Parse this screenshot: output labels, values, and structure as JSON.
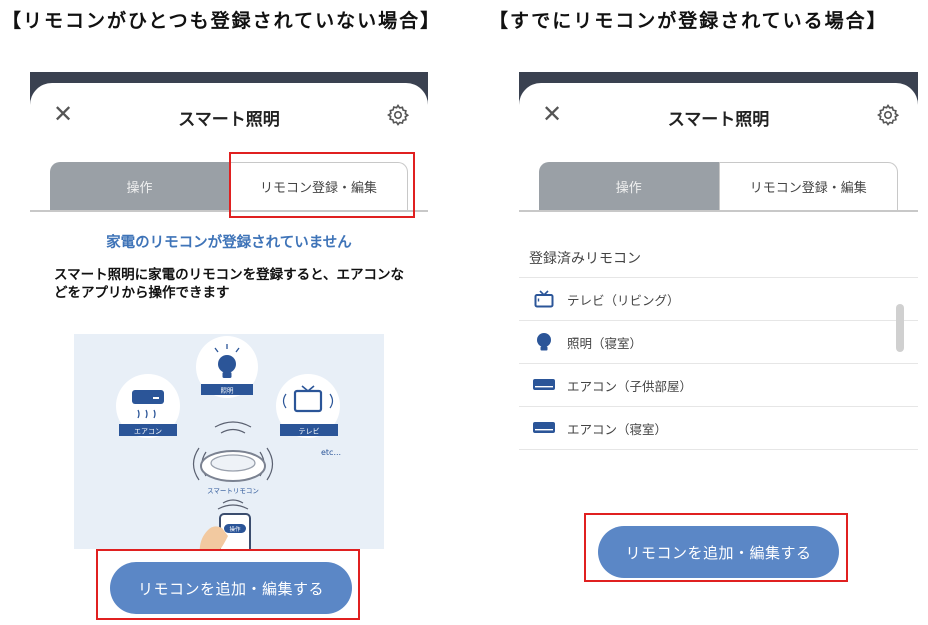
{
  "captions": {
    "left": "【リモコンがひとつも登録されていない場合】",
    "right": "【すでにリモコンが登録されている場合】"
  },
  "left_screen": {
    "title": "スマート照明",
    "close_icon": "close-icon",
    "settings_icon": "gear-icon",
    "tabs": [
      {
        "label": "操作",
        "active": false
      },
      {
        "label": "リモコン登録・編集",
        "active": true
      }
    ],
    "empty_heading": "家電のリモコンが登録されていません",
    "empty_description": "スマート照明に家電のリモコンを登録すると、エアコンなどをアプリから操作できます",
    "illustration": {
      "aircon_label": "エアコン",
      "light_label": "照明",
      "tv_label": "テレビ",
      "etc_label": "etc...",
      "remote_label": "スマートリモコン",
      "operate_label": "操作"
    },
    "primary_button": "リモコンを追加・編集する"
  },
  "right_screen": {
    "title": "スマート照明",
    "close_icon": "close-icon",
    "settings_icon": "gear-icon",
    "tabs": [
      {
        "label": "操作",
        "active": false
      },
      {
        "label": "リモコン登録・編集",
        "active": true
      }
    ],
    "list_title": "登録済みリモコン",
    "remotes": [
      {
        "label": "テレビ（リビング）",
        "icon": "tv-icon"
      },
      {
        "label": "照明（寝室）",
        "icon": "lightbulb-icon"
      },
      {
        "label": "エアコン（子供部屋）",
        "icon": "aircon-icon"
      },
      {
        "label": "エアコン（寝室）",
        "icon": "aircon-icon"
      }
    ],
    "primary_button": "リモコンを追加・編集する"
  },
  "colors": {
    "accent": "#5b87c6",
    "heading_blue": "#3f74b8",
    "inactive_tab": "#9aa0a6",
    "highlight_red": "#e02020",
    "illustration_bg": "#e8eff7",
    "icon_navy": "#2b5598"
  }
}
